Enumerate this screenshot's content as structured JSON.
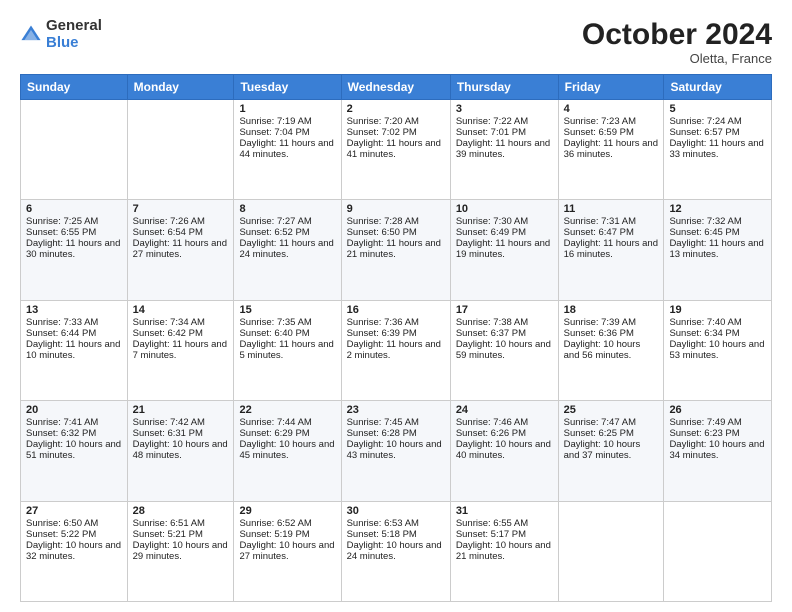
{
  "logo": {
    "general": "General",
    "blue": "Blue"
  },
  "title": "October 2024",
  "location": "Oletta, France",
  "days_header": [
    "Sunday",
    "Monday",
    "Tuesday",
    "Wednesday",
    "Thursday",
    "Friday",
    "Saturday"
  ],
  "weeks": [
    [
      {
        "day": "",
        "content": ""
      },
      {
        "day": "",
        "content": ""
      },
      {
        "day": "1",
        "content": "Sunrise: 7:19 AM\nSunset: 7:04 PM\nDaylight: 11 hours and 44 minutes."
      },
      {
        "day": "2",
        "content": "Sunrise: 7:20 AM\nSunset: 7:02 PM\nDaylight: 11 hours and 41 minutes."
      },
      {
        "day": "3",
        "content": "Sunrise: 7:22 AM\nSunset: 7:01 PM\nDaylight: 11 hours and 39 minutes."
      },
      {
        "day": "4",
        "content": "Sunrise: 7:23 AM\nSunset: 6:59 PM\nDaylight: 11 hours and 36 minutes."
      },
      {
        "day": "5",
        "content": "Sunrise: 7:24 AM\nSunset: 6:57 PM\nDaylight: 11 hours and 33 minutes."
      }
    ],
    [
      {
        "day": "6",
        "content": "Sunrise: 7:25 AM\nSunset: 6:55 PM\nDaylight: 11 hours and 30 minutes."
      },
      {
        "day": "7",
        "content": "Sunrise: 7:26 AM\nSunset: 6:54 PM\nDaylight: 11 hours and 27 minutes."
      },
      {
        "day": "8",
        "content": "Sunrise: 7:27 AM\nSunset: 6:52 PM\nDaylight: 11 hours and 24 minutes."
      },
      {
        "day": "9",
        "content": "Sunrise: 7:28 AM\nSunset: 6:50 PM\nDaylight: 11 hours and 21 minutes."
      },
      {
        "day": "10",
        "content": "Sunrise: 7:30 AM\nSunset: 6:49 PM\nDaylight: 11 hours and 19 minutes."
      },
      {
        "day": "11",
        "content": "Sunrise: 7:31 AM\nSunset: 6:47 PM\nDaylight: 11 hours and 16 minutes."
      },
      {
        "day": "12",
        "content": "Sunrise: 7:32 AM\nSunset: 6:45 PM\nDaylight: 11 hours and 13 minutes."
      }
    ],
    [
      {
        "day": "13",
        "content": "Sunrise: 7:33 AM\nSunset: 6:44 PM\nDaylight: 11 hours and 10 minutes."
      },
      {
        "day": "14",
        "content": "Sunrise: 7:34 AM\nSunset: 6:42 PM\nDaylight: 11 hours and 7 minutes."
      },
      {
        "day": "15",
        "content": "Sunrise: 7:35 AM\nSunset: 6:40 PM\nDaylight: 11 hours and 5 minutes."
      },
      {
        "day": "16",
        "content": "Sunrise: 7:36 AM\nSunset: 6:39 PM\nDaylight: 11 hours and 2 minutes."
      },
      {
        "day": "17",
        "content": "Sunrise: 7:38 AM\nSunset: 6:37 PM\nDaylight: 10 hours and 59 minutes."
      },
      {
        "day": "18",
        "content": "Sunrise: 7:39 AM\nSunset: 6:36 PM\nDaylight: 10 hours and 56 minutes."
      },
      {
        "day": "19",
        "content": "Sunrise: 7:40 AM\nSunset: 6:34 PM\nDaylight: 10 hours and 53 minutes."
      }
    ],
    [
      {
        "day": "20",
        "content": "Sunrise: 7:41 AM\nSunset: 6:32 PM\nDaylight: 10 hours and 51 minutes."
      },
      {
        "day": "21",
        "content": "Sunrise: 7:42 AM\nSunset: 6:31 PM\nDaylight: 10 hours and 48 minutes."
      },
      {
        "day": "22",
        "content": "Sunrise: 7:44 AM\nSunset: 6:29 PM\nDaylight: 10 hours and 45 minutes."
      },
      {
        "day": "23",
        "content": "Sunrise: 7:45 AM\nSunset: 6:28 PM\nDaylight: 10 hours and 43 minutes."
      },
      {
        "day": "24",
        "content": "Sunrise: 7:46 AM\nSunset: 6:26 PM\nDaylight: 10 hours and 40 minutes."
      },
      {
        "day": "25",
        "content": "Sunrise: 7:47 AM\nSunset: 6:25 PM\nDaylight: 10 hours and 37 minutes."
      },
      {
        "day": "26",
        "content": "Sunrise: 7:49 AM\nSunset: 6:23 PM\nDaylight: 10 hours and 34 minutes."
      }
    ],
    [
      {
        "day": "27",
        "content": "Sunrise: 6:50 AM\nSunset: 5:22 PM\nDaylight: 10 hours and 32 minutes."
      },
      {
        "day": "28",
        "content": "Sunrise: 6:51 AM\nSunset: 5:21 PM\nDaylight: 10 hours and 29 minutes."
      },
      {
        "day": "29",
        "content": "Sunrise: 6:52 AM\nSunset: 5:19 PM\nDaylight: 10 hours and 27 minutes."
      },
      {
        "day": "30",
        "content": "Sunrise: 6:53 AM\nSunset: 5:18 PM\nDaylight: 10 hours and 24 minutes."
      },
      {
        "day": "31",
        "content": "Sunrise: 6:55 AM\nSunset: 5:17 PM\nDaylight: 10 hours and 21 minutes."
      },
      {
        "day": "",
        "content": ""
      },
      {
        "day": "",
        "content": ""
      }
    ]
  ]
}
